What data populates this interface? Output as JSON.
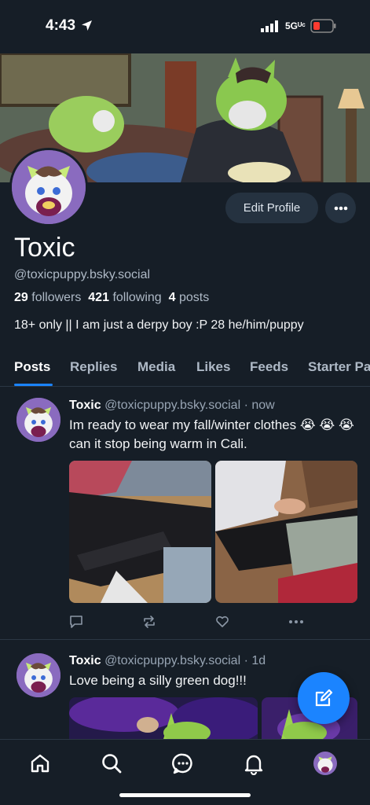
{
  "status_bar": {
    "time": "4:43",
    "network": "5Gᵁᶜ"
  },
  "profile": {
    "display_name": "Toxic",
    "handle": "@toxicpuppy.bsky.social",
    "followers_count": "29",
    "followers_label": "followers",
    "following_count": "421",
    "following_label": "following",
    "posts_count": "4",
    "posts_label": "posts",
    "bio": "18+ only || I am just a derpy boy :P 28 he/him/puppy",
    "edit_button": "Edit Profile",
    "more_glyph": "•••"
  },
  "tabs": [
    "Posts",
    "Replies",
    "Media",
    "Likes",
    "Feeds",
    "Starter Packs"
  ],
  "posts": [
    {
      "name": "Toxic",
      "handle": "@toxicpuppy.bsky.social",
      "time": "· now",
      "text": "Im ready to wear my fall/winter clothes 😭 😭 😭 can it stop being warm in Cali."
    },
    {
      "name": "Toxic",
      "handle": "@toxicpuppy.bsky.social",
      "time": "· 1d",
      "text": "Love being a silly green dog!!!"
    }
  ],
  "colors": {
    "accent": "#1b84ff",
    "background": "#161e27",
    "muted": "#aeb9c6"
  },
  "icons": [
    "location-arrow-icon",
    "signal-icon",
    "battery-icon",
    "reply-icon",
    "repost-icon",
    "like-icon",
    "more-icon",
    "compose-icon",
    "home-icon",
    "search-icon",
    "chat-icon",
    "bell-icon"
  ]
}
